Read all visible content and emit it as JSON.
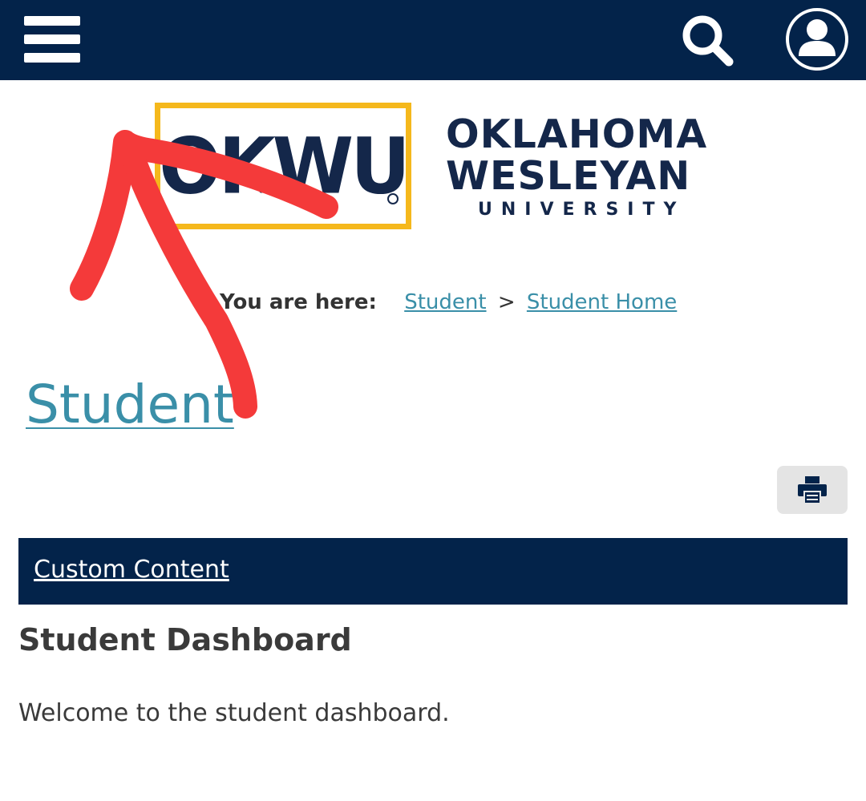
{
  "header": {
    "menu_icon": "hamburger-menu-icon",
    "search_icon": "search-icon",
    "user_icon": "user-account-icon",
    "background_color": "#03234a"
  },
  "logo": {
    "mark": "OKWU",
    "line1": "OKLAHOMA",
    "line2": "WESLEYAN",
    "line3": "UNIVERSITY",
    "accent_color": "#f5b81c",
    "text_color": "#14274a"
  },
  "breadcrumb": {
    "label": "You are here:",
    "items": [
      "Student",
      "Student Home"
    ],
    "separator": ">"
  },
  "page_title": "Student",
  "print_icon": "printer-icon",
  "content_bar": {
    "link": "Custom Content"
  },
  "section": {
    "heading": "Student Dashboard",
    "body": "Welcome to the student dashboard."
  },
  "annotation": {
    "icon": "hand-drawn-red-arrow",
    "color": "#f43a3a"
  },
  "colors": {
    "link": "#3a8fa8",
    "text": "#3a3a3a"
  }
}
